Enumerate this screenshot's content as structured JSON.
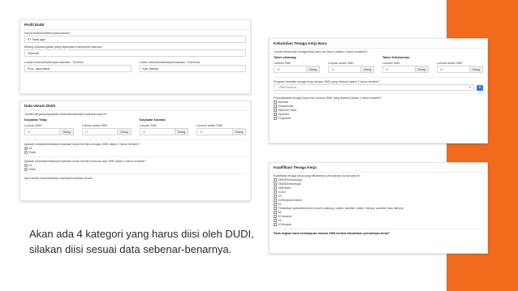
{
  "profil": {
    "title": "Profil DUDI",
    "nama_label": "Nama instansi/institusi/perusahaan:",
    "nama_value": "PT Sinar jaya",
    "bidang_label": "Bidang usaha/kegiatan yang dijalankan institusi/perusahaan:",
    "bidang_value": "Otomotif",
    "prov_label": "Lokasi instansi/institusi/perusahaan - Provinsi",
    "prov_value": "Prov. Jawa Barat",
    "kab_label": "Lokasi instansi/institusi/perusahaan - Kab/Kota",
    "kab_value": "Kab. Bekasi"
  },
  "data_umum": {
    "title": "Data Umum DUDI",
    "jumlah_label": "Jumlah karyawan/pegawai instansi/institusi/perusahaan saat ini:",
    "tetap_label": "Karyawan Tetap:",
    "kontrak_label": "Karyawan Kontrak:",
    "lulusan_smk": "Lulusan SMK",
    "lulusan_selain": "Lulusan selain SMK",
    "num_value": "00",
    "unit": "Orang",
    "q1": "Apakah instansi/institusi/perusahaan Anda bermitra dengan SMK dalam 2 tahun terakhir?",
    "q2": "Apakah instansi/institusi/perusahaan Anda merekrut lulusan dari SMK dalam 2 tahun terakhir?",
    "ya": "Ya",
    "tidak": "Tidak",
    "q3": "Apa bentuk instansi/badan usaha/perusahaan Anda?"
  },
  "kebutuhan": {
    "title": "Kebutuhan Tenaga Kerja Baru",
    "jumlah_label": "Jumlah kebutuhan tenaga kerja baru per tahun (dalam 2 tahun terakhir)?",
    "tahun_ini": "Tahun sekarang:",
    "tahun_lalu": "Tahun Sebelumnya:",
    "lulusan_smk": "Lulusan SMK",
    "lulusan_selain": "Lulusan selain SMK",
    "num_value": "00",
    "unit": "Orang",
    "program_label": "Program keahlian tenaga kerja lulusan SMK yang direkrut dalam 2 tahun terakhir?",
    "program_placeholder": "-- Pilih Prov/Kot --",
    "plus": "+",
    "posisi_label": "Posisi/jabatan tenaga kerja baru lulusan SMK yang direkrut dalam 2 tahun terakhir?",
    "posisi": [
      "Mekanik",
      "Receptionist",
      "Staf front office",
      "Operator",
      "Programer"
    ]
  },
  "kualifikasi": {
    "title": "Kualifikasi Tenaga Kerja",
    "label": "Kualifikasi tenaga kerja yang dibutuhkan perusahaan Anda saat ini:",
    "items": [
      "SMP/MTs/sederajat",
      "SMA/MA/sederajat",
      "SMK/MAK",
      "D1/D2",
      "D3",
      "D4/Sarjana terapan",
      "S1",
      "Pendidikan spesialis/profesi (contoh: psikolog, notaris, akuntan, dokter, insinyur, apoteker atau lainnya)",
      "S2",
      "S2 terapan",
      "S3",
      "S3 terapan"
    ],
    "question": "Pada tingkat mana kemampuan lulusan SMK berikut dibutuhkan perusahaan Anda?"
  },
  "caption": {
    "line1": "Akan ada 4 kategori yang harus diisi oleh DUDI,",
    "line2": "silakan diisi sesuai data sebenar-benarnya."
  }
}
